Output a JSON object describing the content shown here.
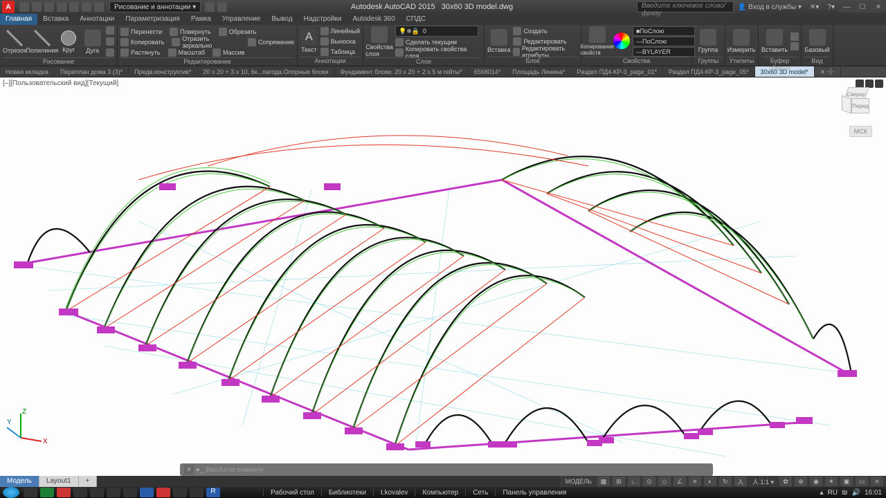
{
  "app": {
    "title": "Autodesk AutoCAD 2015",
    "filename": "30x60 3D model.dwg",
    "workspace": "Рисование и аннотации",
    "search_placeholder": "Введите ключевое слово/фразу",
    "account": "Вход в службы"
  },
  "menu": [
    "Главная",
    "Вставка",
    "Аннотации",
    "Параметризация",
    "Рамка",
    "Управление",
    "Вывод",
    "Надстройки",
    "Autodesk 360",
    "СПДС"
  ],
  "ribbon": {
    "draw": {
      "label": "Рисование",
      "items": [
        "Отрезок",
        "Полилиния",
        "Круг",
        "Дуга"
      ]
    },
    "edit": {
      "label": "Редактирование",
      "rows": [
        [
          "Перенести",
          "Повернуть",
          "Обрезать"
        ],
        [
          "Копировать",
          "Отразить зеркально",
          "Сопряжение"
        ],
        [
          "Растянуть",
          "Масштаб",
          "Массив"
        ]
      ]
    },
    "annot": {
      "label": "Аннотации",
      "text": "Текст",
      "rows": [
        "Линейный",
        "Выноска",
        "Таблица"
      ]
    },
    "layers": {
      "label": "Слои",
      "btn": "Свойства слоя",
      "rows": [
        "Сделать текущим",
        "Копировать свойства слоя"
      ],
      "value": "0"
    },
    "block": {
      "label": "Блок",
      "insert": "Вставка",
      "rows": [
        "Создать",
        "Редактировать",
        "Редактировать атрибуты"
      ]
    },
    "props": {
      "label": "Свойства",
      "btn": "Копирование свойств",
      "bylayer": "ПоСлою",
      "bylayer2": "ПоСлою",
      "bylayer3": "BYLAYER"
    },
    "groups": {
      "label": "Группы",
      "btn": "Группа"
    },
    "utils": {
      "label": "Утилиты",
      "btn": "Измерить"
    },
    "clip": {
      "label": "Буфер обмена",
      "btn": "Вставить"
    },
    "view": {
      "label": "Вид",
      "btn": "Базовый"
    }
  },
  "doc_tabs": [
    "Новая вкладка",
    "Переплан дома 3 (3)*",
    "Предв.конструктив*",
    "20 x 20 + 3 x 10, 6к...пагода.Опорные блоки",
    "Фундамент блоки. 20 x 20 + 2 x 5 м гейты*",
    "6568014*",
    "Площадь Ленина*",
    "Раздел ПД4-КР-3_page_01*",
    "Раздел ПД4-КР-3_page_05*",
    "30x60 3D model*"
  ],
  "active_doc": 9,
  "viewport": {
    "label": "[–][Пользовательский вид][Текущий]",
    "msk": "МСК",
    "cube": {
      "top": "Сверху",
      "front": "Перед"
    }
  },
  "ucs": {
    "x": "X",
    "y": "Y",
    "z": "Z"
  },
  "cmd": {
    "prompt": "Введите команду"
  },
  "model_tabs": [
    "Модель",
    "Layout1"
  ],
  "status": {
    "model": "МОДЕЛЬ",
    "scale": "1:1"
  },
  "taskbar": {
    "folders": [
      "Рабочий стол",
      "Библиотеки",
      "t.kovalev",
      "Компьютер",
      "Сеть",
      "Панель управления"
    ],
    "lang": "RU",
    "time": "16:01"
  }
}
